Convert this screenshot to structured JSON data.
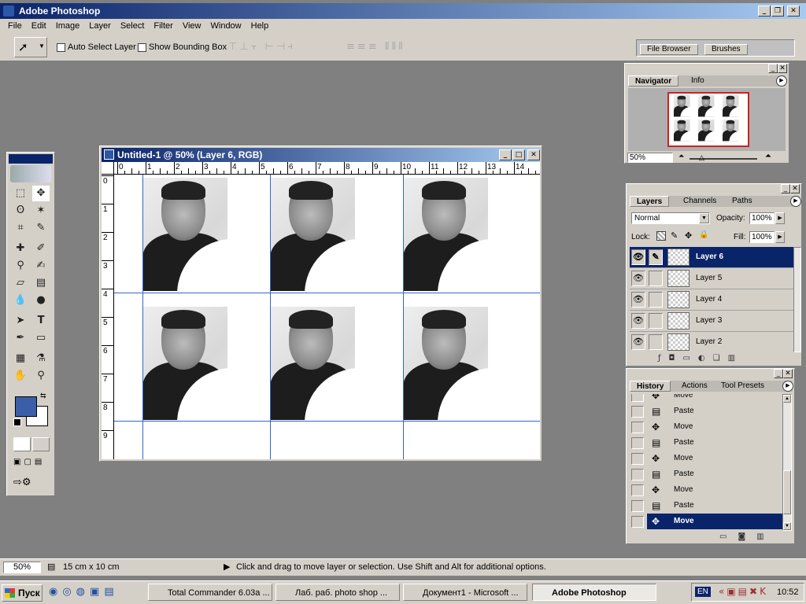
{
  "app": {
    "title": "Adobe Photoshop"
  },
  "menu": [
    "File",
    "Edit",
    "Image",
    "Layer",
    "Select",
    "Filter",
    "View",
    "Window",
    "Help"
  ],
  "options": {
    "auto_select": "Auto Select Layer",
    "bounding_box": "Show Bounding Box"
  },
  "well_tabs": [
    "File Browser",
    "Brushes"
  ],
  "document": {
    "title": "Untitled-1 @ 50% (Layer 6, RGB)",
    "ruler_h": [
      "0",
      "1",
      "2",
      "3",
      "4",
      "5",
      "6",
      "7",
      "8",
      "9",
      "10",
      "11",
      "12",
      "13",
      "14"
    ],
    "ruler_v": [
      "0",
      "1",
      "2",
      "3",
      "4",
      "5",
      "6",
      "7",
      "8",
      "9"
    ]
  },
  "navigator": {
    "tabs": [
      "Navigator",
      "Info"
    ],
    "zoom": "50%"
  },
  "layers": {
    "tabs": [
      "Layers",
      "Channels",
      "Paths"
    ],
    "blend_mode": "Normal",
    "opacity_label": "Opacity:",
    "opacity": "100%",
    "lock_label": "Lock:",
    "fill_label": "Fill:",
    "fill": "100%",
    "items": [
      "Layer 6",
      "Layer 5",
      "Layer 4",
      "Layer 3",
      "Layer 2"
    ]
  },
  "history": {
    "tabs": [
      "History",
      "Actions",
      "Tool Presets"
    ],
    "items": [
      "Move",
      "Paste",
      "Move",
      "Paste",
      "Move",
      "Paste",
      "Move",
      "Paste",
      "Move"
    ]
  },
  "status": {
    "zoom": "50%",
    "doc_size": "15 cm x 10 cm",
    "hint": "Click and drag to move layer or selection.  Use Shift and Alt for additional options."
  },
  "taskbar": {
    "start": "Пуск",
    "tasks": [
      "Total Commander 6.03a ...",
      "Лаб. раб. photo shop ...",
      "Документ1 - Microsoft ...",
      "Adobe Photoshop"
    ],
    "lang": "EN",
    "clock": "10:52"
  },
  "colors": {
    "titlebar": "#0a246a",
    "foreground": "#3a5fa8",
    "selection": "#0a246a",
    "guides": "#3366cc"
  }
}
